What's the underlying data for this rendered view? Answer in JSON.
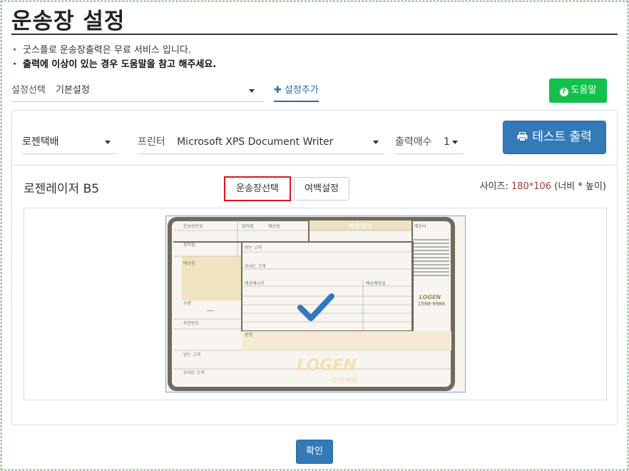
{
  "page": {
    "title": "운송장 설정"
  },
  "notes": [
    "굿스플로 운송장출력은 무료 서비스 입니다.",
    "출력에 이상이 있는 경우 도움말을 참고 해주세요."
  ],
  "preset": {
    "label": "설정선택",
    "value": "기본설정"
  },
  "add_preset_label": "설정추가",
  "help_label": "도움말",
  "courier": {
    "value": "로젠택배"
  },
  "printer": {
    "label": "프린터",
    "value": "Microsoft XPS Document Writer"
  },
  "copies": {
    "label": "출력매수",
    "value": "1"
  },
  "test_print_label": "테스트 출력",
  "label_type": "로젠레이저 B5",
  "select_label_button": "운송장선택",
  "margin_button": "여백설정",
  "size": {
    "prefix": "사이즈:",
    "value": "180*106",
    "suffix": "(너비 * 높이)"
  },
  "waybill": {
    "brand": "LOGEN",
    "phone": "1588-9988",
    "company": "로젠택배",
    "fields": {
      "tracking_no": "운송장번호",
      "pickup": "집하점",
      "delivery": "배송점",
      "receiver": "받는 고객",
      "sender": "보내는 고객",
      "message": "배송메시지",
      "quantity": "수량",
      "order_no": "주문번호",
      "fare": "운임",
      "item": "품명",
      "delivery_date": "배송예정일",
      "guide": "배송사",
      "header_band": "배송정보"
    }
  },
  "confirm_label": "확인",
  "colors": {
    "primary": "#337ab7",
    "help": "#12c04a",
    "highlight": "#e0141e",
    "size_value": "#a0413a"
  }
}
